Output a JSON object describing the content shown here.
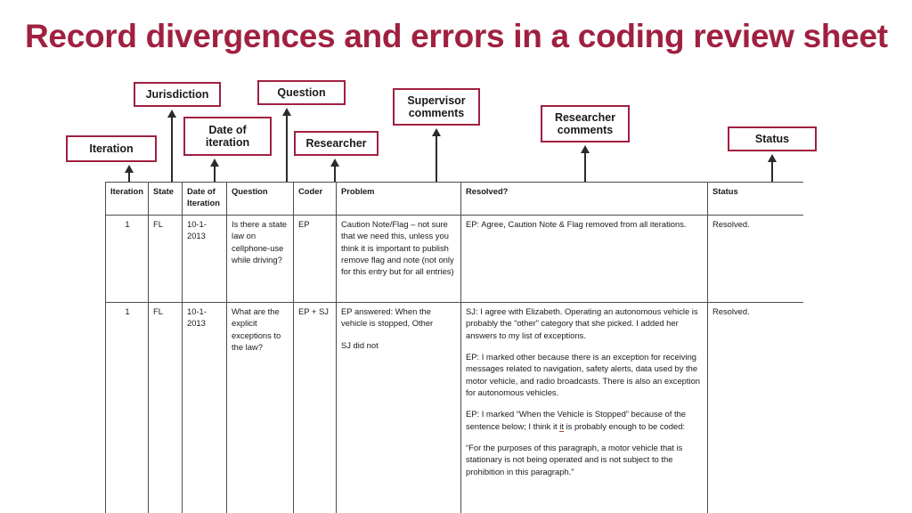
{
  "slide": {
    "title": "Record divergences and errors in a coding review sheet",
    "title_color": "#a02040",
    "callout_border_color": "#a02040",
    "arrow_color": "#2b2b2b"
  },
  "callouts": [
    {
      "id": "iteration",
      "label": "Iteration"
    },
    {
      "id": "jurisdiction",
      "label": "Jurisdiction"
    },
    {
      "id": "date",
      "label": "Date of iteration"
    },
    {
      "id": "question",
      "label": "Question"
    },
    {
      "id": "researcher",
      "label": "Researcher"
    },
    {
      "id": "supervisor",
      "label": "Supervisor comments"
    },
    {
      "id": "researcher-comments",
      "label": "Researcher comments"
    },
    {
      "id": "status",
      "label": "Status"
    }
  ],
  "table": {
    "headers": [
      "Iteration",
      "State",
      "Date of Iteration",
      "Question",
      "Coder",
      "Problem",
      "Resolved?",
      "Status"
    ],
    "rows": [
      {
        "iteration": "1",
        "state": "FL",
        "date": "10-1-2013",
        "question": "Is there a state law on cellphone-use while driving?",
        "coder": "EP",
        "problem": "Caution Note/Flag – not sure that we need this, unless you think it is important to publish remove flag and note (not only for this entry but for all entries)",
        "resolved": [
          "EP: Agree, Caution Note & Flag removed from all iterations."
        ],
        "status": "Resolved."
      },
      {
        "iteration": "1",
        "state": "FL",
        "date": "10-1-2013",
        "question": "What are the explicit exceptions to the law?",
        "coder": "EP + SJ",
        "problem_paras": [
          "EP answered: When the vehicle is stopped, Other",
          "SJ did not"
        ],
        "resolved": [
          "SJ: I agree with Elizabeth. Operating an autonomous vehicle is probably the “other” category that she picked. I added her answers to my list of exceptions.",
          "EP: I marked other because there is an exception for receiving messages related to navigation, safety alerts, data used by the motor vehicle, and radio broadcasts. There is also an exception for autonomous vehicles."
        ],
        "resolved_last_prefix": "EP: I marked “When the Vehicle is Stopped” because of the sentence below; I think it ",
        "resolved_last_misspell": "it",
        "resolved_last_suffix": " is probably enough to be coded:",
        "resolved_quote": "“For the purposes of this paragraph, a motor vehicle that is stationary is not being operated and is not subject to the prohibition in this paragraph.”",
        "status": "Resolved."
      }
    ]
  }
}
